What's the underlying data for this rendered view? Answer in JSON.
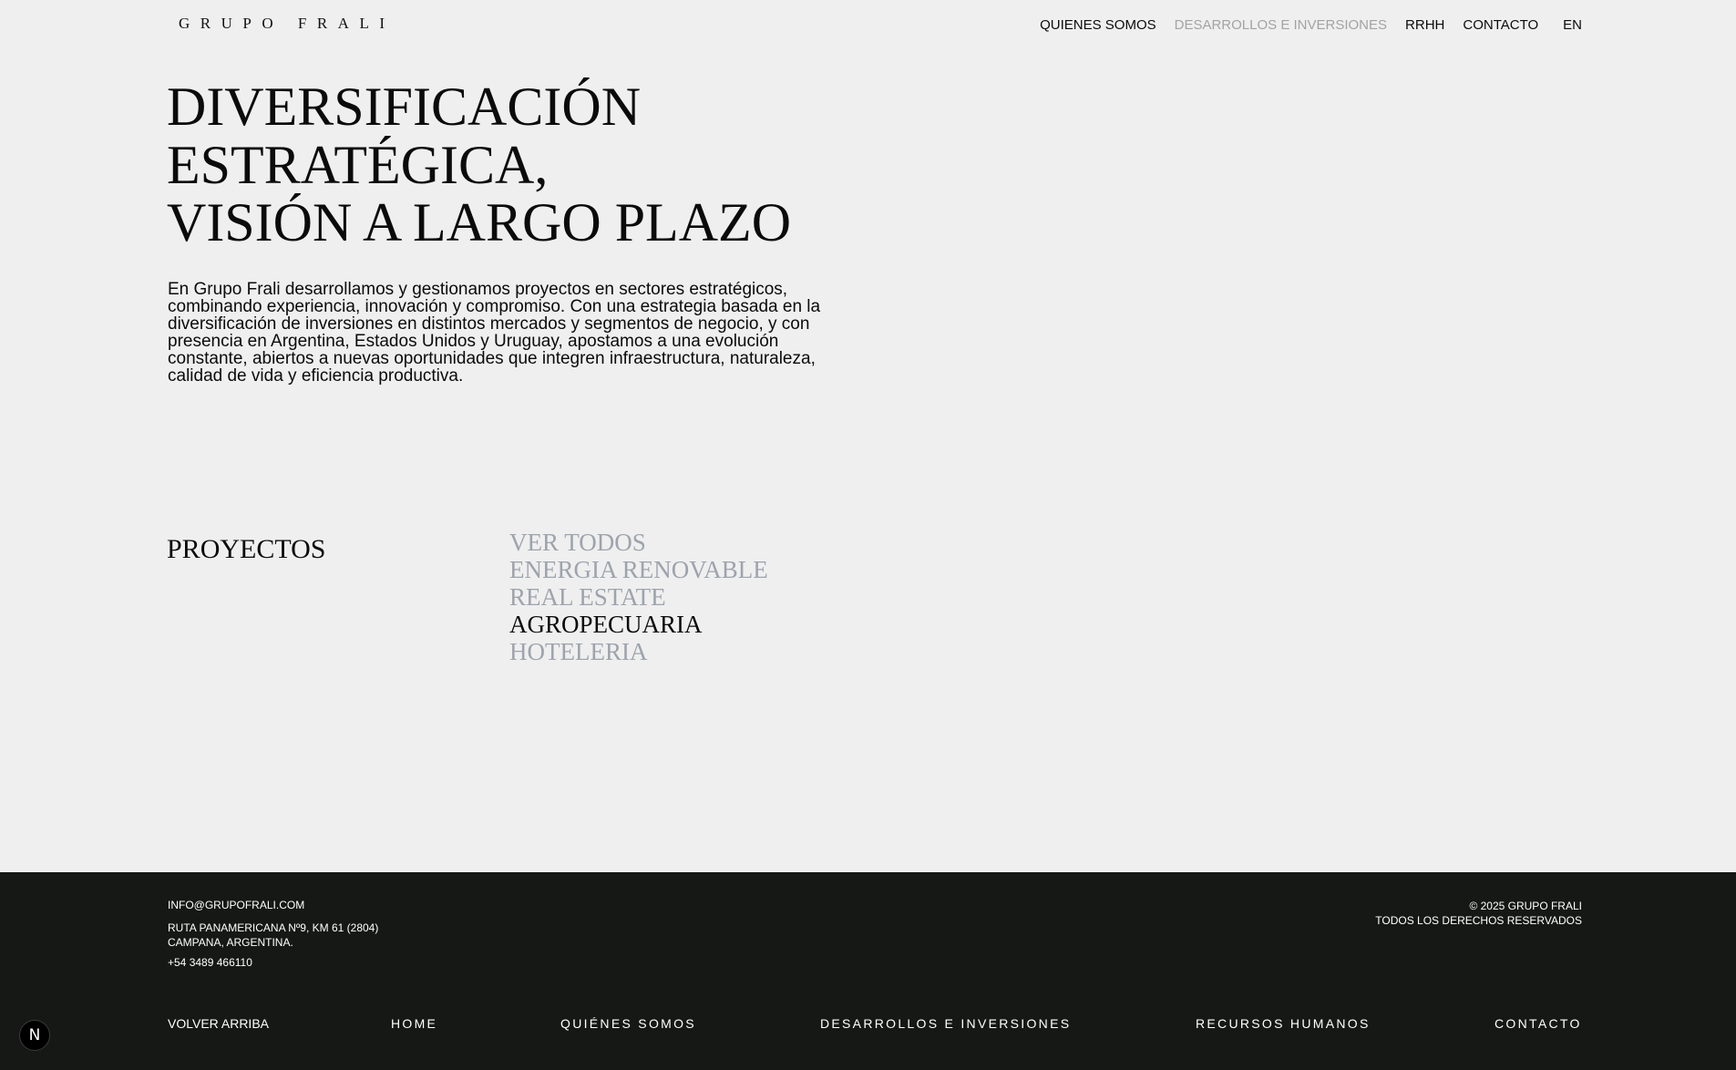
{
  "header": {
    "logo": "GRUPO FRALI",
    "nav": [
      {
        "label": "QUIENES SOMOS",
        "active": false
      },
      {
        "label": "DESARROLLOS E INVERSIONES",
        "active": true
      },
      {
        "label": "RRHH",
        "active": false
      },
      {
        "label": "CONTACTO",
        "active": false
      }
    ],
    "language": "EN"
  },
  "hero": {
    "title_lines": [
      "DIVERSIFICACIÓN",
      "ESTRATÉGICA,",
      "VISIÓN A LARGO PLAZO"
    ],
    "description": "En Grupo Frali desarrollamos y gestionamos proyectos en sectores estratégicos, combinando experiencia, innovación y compromiso. Con una estrategia basada en la diversificación de inversiones en distintos mercados y segmentos de negocio, y con presencia en Argentina, Estados Unidos y Uruguay, apostamos a una evolución constante, abiertos a nuevas oportunidades que integren infraestructura, naturaleza, calidad de vida y eficiencia productiva."
  },
  "projects": {
    "label": "PROYECTOS",
    "filters": [
      {
        "label": "VER TODOS",
        "active": false
      },
      {
        "label": "ENERGIA RENOVABLE",
        "active": false
      },
      {
        "label": "REAL ESTATE",
        "active": false
      },
      {
        "label": "AGROPECUARIA",
        "active": true
      },
      {
        "label": "HOTELERIA",
        "active": false
      }
    ]
  },
  "footer": {
    "email": "INFO@GRUPOFRALI.COM",
    "address_lines": [
      "RUTA PANAMERICANA Nº9, KM 61 (2804)",
      "CAMPANA, ARGENTINA."
    ],
    "phone": "+54 3489 466110",
    "copyright": "© 2025 GRUPO FRALI",
    "rights": "TODOS LOS DERECHOS RESERVADOS",
    "back_to_top": "VOLVER ARRIBA",
    "nav": [
      "HOME",
      "QUIÉNES SOMOS",
      "DESARROLLOS E INVERSIONES",
      "RECURSOS HUMANOS",
      "CONTACTO"
    ]
  },
  "badge": {
    "letter": "N",
    "background": "#000000"
  },
  "colors": {
    "background": "#efefef",
    "text": "#0b0b0b",
    "muted_nav": "#a3a3a3",
    "muted_filter": "#9ea3ad",
    "footer_bg": "#161816",
    "footer_text": "#ffffff"
  }
}
